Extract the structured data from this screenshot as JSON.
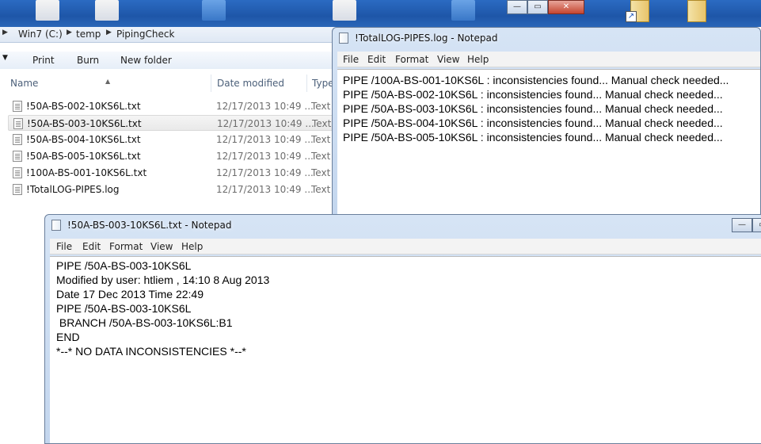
{
  "explorer": {
    "breadcrumb": [
      "Win7 (C:)",
      "temp",
      "PipingCheck"
    ],
    "commands": [
      "Print",
      "Burn",
      "New folder"
    ],
    "columns": [
      "Name",
      "Date modified",
      "Type"
    ],
    "files": [
      {
        "name": "!50A-BS-002-10KS6L.txt",
        "date": "12/17/2013 10:49 ...",
        "type": "Text"
      },
      {
        "name": "!50A-BS-003-10KS6L.txt",
        "date": "12/17/2013 10:49 ...",
        "type": "Text"
      },
      {
        "name": "!50A-BS-004-10KS6L.txt",
        "date": "12/17/2013 10:49 ...",
        "type": "Text"
      },
      {
        "name": "!50A-BS-005-10KS6L.txt",
        "date": "12/17/2013 10:49 ...",
        "type": "Text"
      },
      {
        "name": "!100A-BS-001-10KS6L.txt",
        "date": "12/17/2013 10:49 ...",
        "type": "Text"
      },
      {
        "name": "!TotalLOG-PIPES.log",
        "date": "12/17/2013 10:49 ...",
        "type": "Text"
      }
    ],
    "selected_index": 1
  },
  "notepad_log": {
    "title": "!TotalLOG-PIPES.log - Notepad",
    "menu": [
      "File",
      "Edit",
      "Format",
      "View",
      "Help"
    ],
    "content": "PIPE /100A-BS-001-10KS6L : inconsistencies found... Manual check needed...\nPIPE /50A-BS-002-10KS6L : inconsistencies found... Manual check needed...\nPIPE /50A-BS-003-10KS6L : inconsistencies found... Manual check needed...\nPIPE /50A-BS-004-10KS6L : inconsistencies found... Manual check needed...\nPIPE /50A-BS-005-10KS6L : inconsistencies found... Manual check needed..."
  },
  "notepad_file": {
    "title": "!50A-BS-003-10KS6L.txt - Notepad",
    "menu": [
      "File",
      "Edit",
      "Format",
      "View",
      "Help"
    ],
    "content": "PIPE /50A-BS-003-10KS6L\nModified by user: htliem , 14:10 8 Aug 2013\nDate 17 Dec 2013 Time 22:49\nPIPE /50A-BS-003-10KS6L\n BRANCH /50A-BS-003-10KS6L:B1\nEND\n*--* NO DATA INCONSISTENCIES *--*"
  },
  "icons": {
    "window_controls": [
      "minimize-icon",
      "maximize-icon",
      "close-icon"
    ],
    "file": "text-file-icon",
    "notepad": "notepad-icon"
  },
  "colors": {
    "desktop": "#1e56a8",
    "notepad_frame": "#c3d6ee",
    "selection": "#e9e9e9"
  }
}
